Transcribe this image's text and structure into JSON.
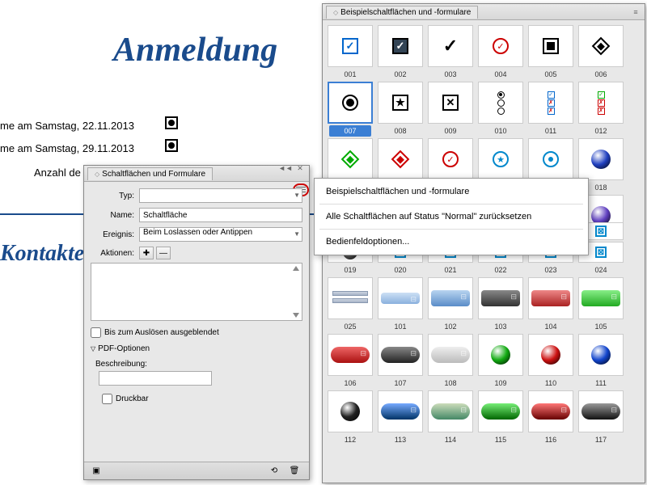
{
  "doc": {
    "title": "Anmeldung",
    "line1": "me am Samstag, 22.11.2013",
    "line2": "me am Samstag, 29.11.2013",
    "line3": "Anzahl de",
    "heading2": "Kontakte"
  },
  "left_panel": {
    "title": "Schaltflächen und Formulare",
    "type_label": "Typ:",
    "type_value": "",
    "name_label": "Name:",
    "name_value": "Schaltfläche",
    "event_label": "Ereignis:",
    "event_value": "Beim Loslassen oder Antippen",
    "actions_label": "Aktionen:",
    "hidden_label": "Bis zum Auslösen ausgeblendet",
    "pdf_section": "PDF-Optionen",
    "desc_label": "Beschreibung:",
    "printable_label": "Druckbar"
  },
  "right_panel": {
    "title": "Beispielschaltflächen und -formulare",
    "labels": [
      "001",
      "002",
      "003",
      "004",
      "005",
      "006",
      "007",
      "008",
      "009",
      "010",
      "011",
      "012",
      "018",
      "019",
      "020",
      "021",
      "022",
      "023",
      "024",
      "025",
      "101",
      "102",
      "103",
      "104",
      "105",
      "106",
      "107",
      "108",
      "109",
      "110",
      "111",
      "112",
      "113",
      "114",
      "115",
      "116",
      "117"
    ]
  },
  "menu": {
    "item1": "Beispielschaltflächen und -formulare",
    "item2": "Alle Schaltflächen auf Status \"Normal\" zurücksetzen",
    "item3": "Bedienfeldoptionen..."
  }
}
